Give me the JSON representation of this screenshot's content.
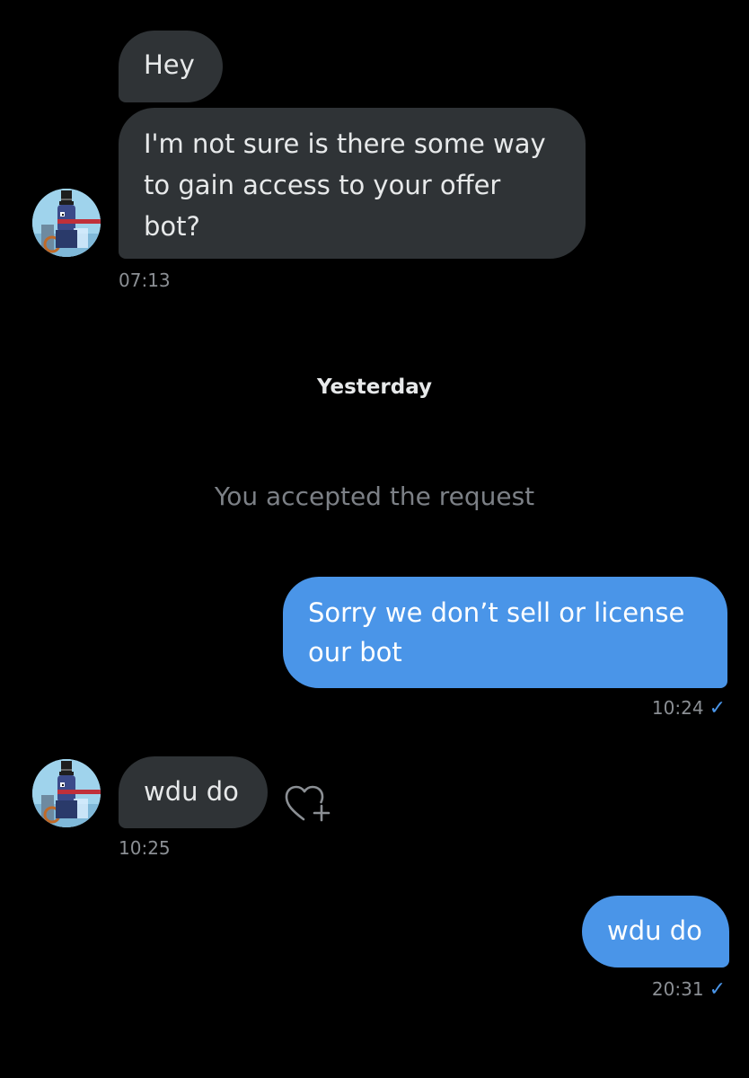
{
  "conversation": {
    "messages": [
      {
        "id": "m1",
        "direction": "incoming",
        "text": "Hey"
      },
      {
        "id": "m2",
        "direction": "incoming",
        "lines": [
          "I'm not sure is there some way",
          "to gain access to your offer",
          "bot?"
        ],
        "time": "07:13"
      },
      {
        "id": "m3",
        "direction": "outgoing",
        "lines": [
          "Sorry we don’t sell or license",
          "our bot"
        ],
        "time": "10:24"
      },
      {
        "id": "m4",
        "direction": "incoming",
        "text": "wdu do",
        "time": "10:25"
      },
      {
        "id": "m5",
        "direction": "outgoing",
        "text": "wdu do",
        "time": "20:31"
      }
    ],
    "day_separator": "Yesterday",
    "system_note": "You accepted the request",
    "read_check": "✓"
  },
  "icons": {
    "avatar": "top-hat-character-avatar-icon",
    "react": "heart-plus-icon"
  },
  "colors": {
    "background": "#000000",
    "incoming_bubble": "#2f3336",
    "outgoing_bubble": "#4a95e8",
    "timestamp": "#8b8f94",
    "system_note": "#7c8086"
  }
}
